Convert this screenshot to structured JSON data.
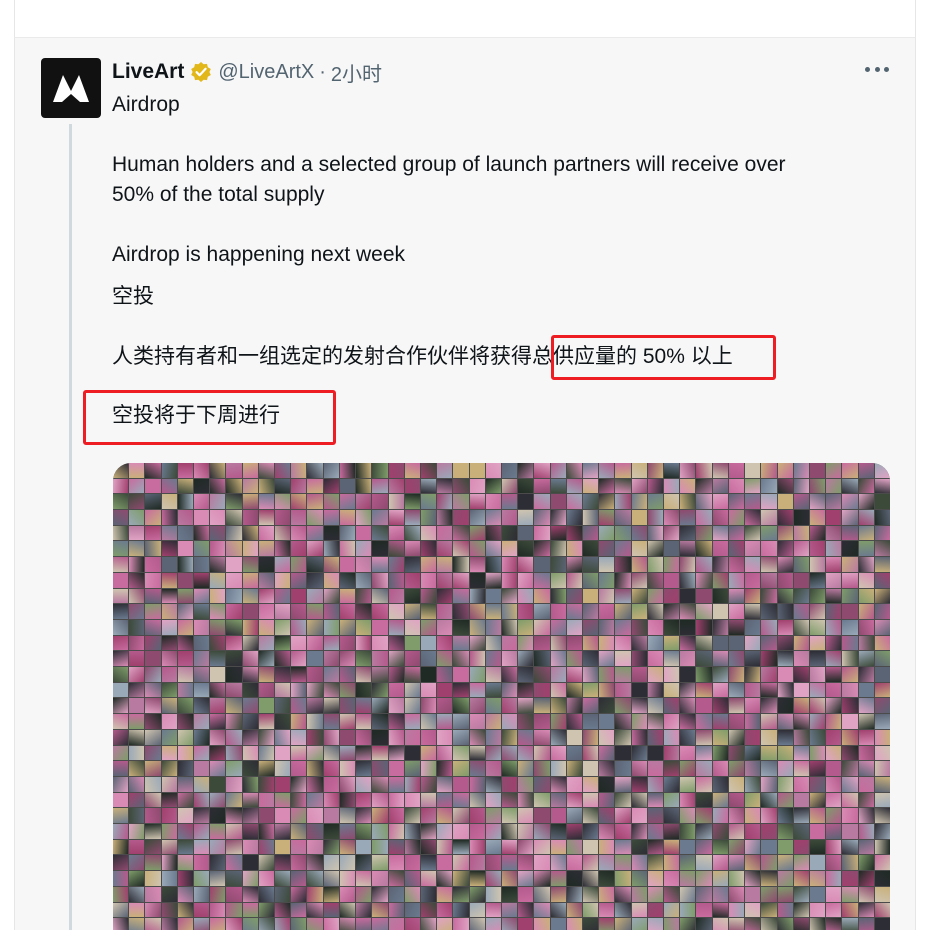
{
  "tweet": {
    "display_name": "LiveArt",
    "handle": "@LiveArtX",
    "separator": "·",
    "time": "2小时",
    "lines": {
      "title": "Airdrop",
      "en_line1": "Human holders and a selected group of launch partners will receive over",
      "en_line2": "50% of the total supply",
      "en_line3": "Airdrop is happening next week",
      "zh_title": "空投",
      "zh_line1": "人类持有者和一组选定的发射合作伙伴将获得总供应量的 50% 以上",
      "zh_line2": "空投将于下周进行"
    }
  },
  "icons": {
    "avatar": "liveart-logo",
    "verified": "verified-badge-icon",
    "more": "more-options-icon"
  },
  "colors": {
    "highlight": "#ee1d23",
    "verified_gold": "#e2b719",
    "tweet_bg": "#f7f7f7",
    "secondary_text": "#536471"
  }
}
